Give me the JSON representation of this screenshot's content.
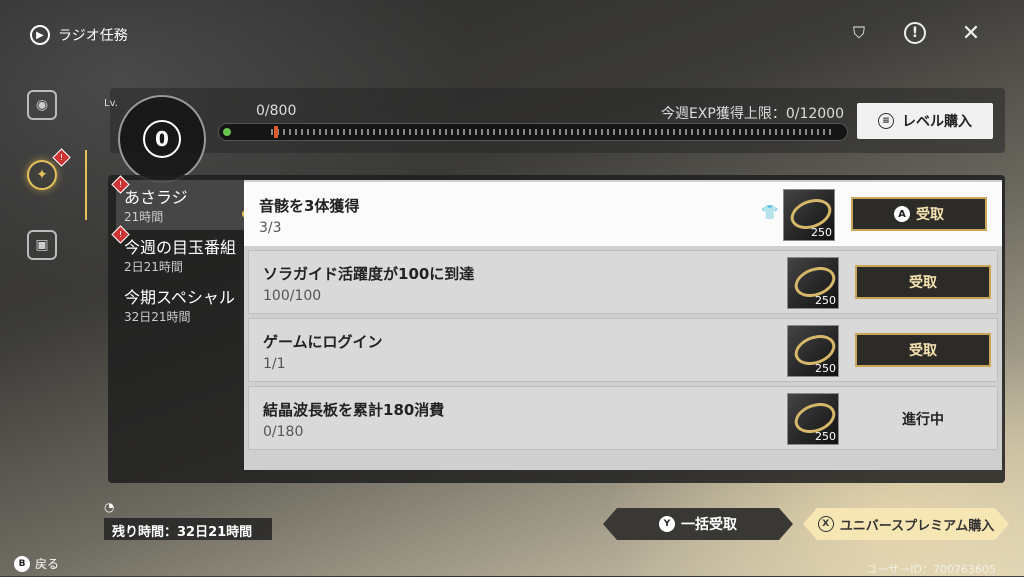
{
  "header": {
    "title": "ラジオ任務",
    "top_icons": [
      "reward-icon",
      "notice-icon",
      "close-icon"
    ]
  },
  "sidebar": {
    "items": [
      {
        "icon": "radio-icon",
        "active": false
      },
      {
        "icon": "mission-icon",
        "active": true,
        "badge": "!"
      },
      {
        "icon": "box-icon",
        "active": false
      }
    ]
  },
  "level": {
    "label": "Lv.",
    "value": "0",
    "exp": "0/800",
    "exp_fraction": 0.0,
    "weekly_limit": "今週EXP獲得上限：0/12000",
    "buy_label": "レベル購入"
  },
  "categories": [
    {
      "name": "あさラジ",
      "time": "21時間",
      "badge": "!"
    },
    {
      "name": "今週の目玉番組",
      "time": "2日21時間",
      "badge": "!"
    },
    {
      "name": "今期スペシャル",
      "time": "32日21時間"
    }
  ],
  "tasks": [
    {
      "title": "音骸を3体獲得",
      "progress": "3/3",
      "reward_qty": "250",
      "action": "受取",
      "key": "A"
    },
    {
      "title": "ソラガイド活躍度が100に到達",
      "progress": "100/100",
      "reward_qty": "250",
      "action": "受取"
    },
    {
      "title": "ゲームにログイン",
      "progress": "1/1",
      "reward_qty": "250",
      "action": "受取"
    },
    {
      "title": "結晶波長板を累計180消費",
      "progress": "0/180",
      "reward_qty": "250",
      "status": "進行中"
    }
  ],
  "footer": {
    "remaining": "残り時間：32日21時間",
    "bulk_key": "Y",
    "bulk_label": "一括受取",
    "premium_key": "X",
    "premium_label": "ユニバースプレミアム購入",
    "back_key": "B",
    "back_label": "戻る",
    "uid": "ユーザーID：700763605"
  }
}
